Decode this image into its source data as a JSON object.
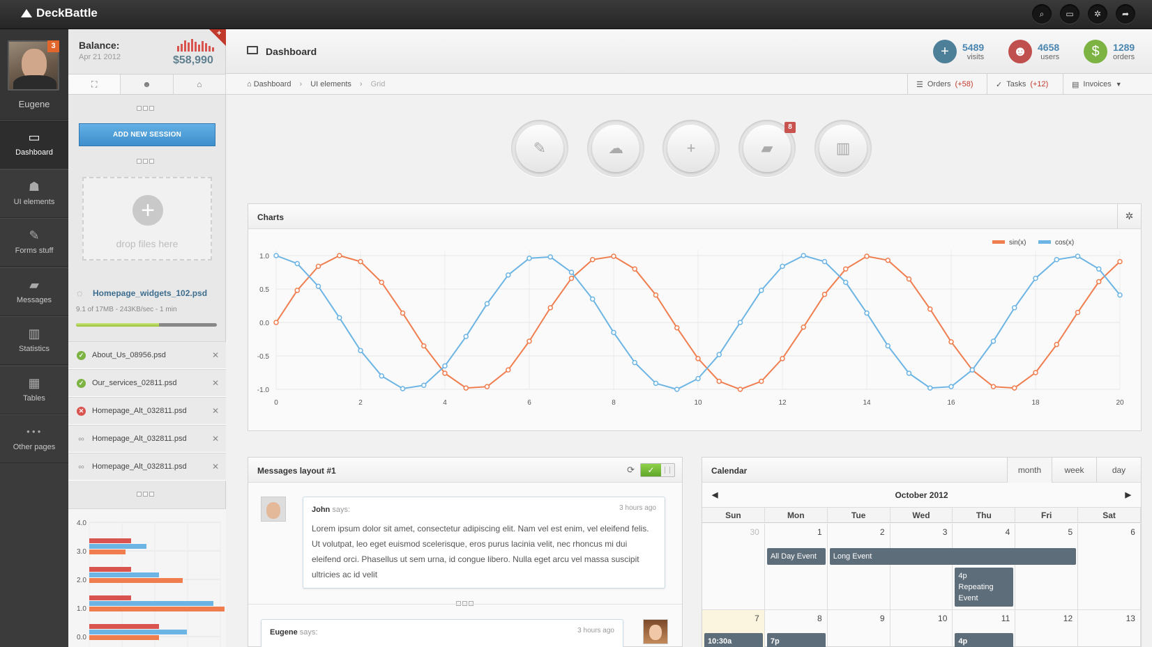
{
  "app": {
    "name": "DeckBattle"
  },
  "topbar": {
    "icons": [
      "search-icon",
      "monitor-icon",
      "gear-icon",
      "share-icon"
    ]
  },
  "user": {
    "name": "Eugene",
    "notifications": "3"
  },
  "nav": {
    "items": [
      {
        "label": "Dashboard",
        "icon": "monitor-icon",
        "glyph": "▭"
      },
      {
        "label": "UI elements",
        "icon": "users-icon",
        "glyph": "☗"
      },
      {
        "label": "Forms stuff",
        "icon": "edit-icon",
        "glyph": "✎"
      },
      {
        "label": "Messages",
        "icon": "chat-icon",
        "glyph": "▰"
      },
      {
        "label": "Statistics",
        "icon": "bar-chart-icon",
        "glyph": "▥"
      },
      {
        "label": "Tables",
        "icon": "table-icon",
        "glyph": "▦"
      },
      {
        "label": "Other pages",
        "icon": "more-icon",
        "glyph": "●●●"
      }
    ]
  },
  "balance": {
    "label": "Balance:",
    "date": "Apr 21 2012",
    "value": "$58,990",
    "ribbon": "+"
  },
  "side": {
    "add_session": "ADD NEW SESSION",
    "drop": "drop files here",
    "upload": {
      "file": "Homepage_widgets_102.psd",
      "meta": "9.1 of 17MB - 243KB/sec - 1 min",
      "progress": 0.59
    },
    "files": [
      {
        "name": "About_Us_08956.psd",
        "status": "done"
      },
      {
        "name": "Our_services_02811.psd",
        "status": "done"
      },
      {
        "name": "Homepage_Alt_032811.psd",
        "status": "error"
      },
      {
        "name": "Homepage_Alt_032811.psd",
        "status": "pending"
      },
      {
        "name": "Homepage_Alt_032811.psd",
        "status": "pending"
      }
    ],
    "mini_chart": {
      "ticks": [
        "4.0",
        "3.0",
        "2.0",
        "1.0",
        "0.0"
      ]
    }
  },
  "header": {
    "title": "Dashboard",
    "stats": [
      {
        "value": "5489",
        "label": "visits",
        "color": "#4e7f99",
        "glyph": "+"
      },
      {
        "value": "4658",
        "label": "users",
        "color": "#c0504d",
        "glyph": "☻"
      },
      {
        "value": "1289",
        "label": "orders",
        "color": "#7cb342",
        "glyph": "$"
      }
    ]
  },
  "breadcrumb": [
    "Dashboard",
    "UI elements",
    "Grid"
  ],
  "quick": {
    "orders": {
      "label": "Orders",
      "count": "(+58)"
    },
    "tasks": {
      "label": "Tasks",
      "count": "(+12)"
    },
    "invoices": {
      "label": "Invoices"
    }
  },
  "circle_buttons": [
    {
      "icon": "edit-icon",
      "glyph": "✎"
    },
    {
      "icon": "cloud-upload-icon",
      "glyph": "☁"
    },
    {
      "icon": "plus-icon",
      "glyph": "+"
    },
    {
      "icon": "chat-icon",
      "glyph": "▰"
    },
    {
      "icon": "bar-chart-icon",
      "glyph": "▥"
    }
  ],
  "circle_badge": "8",
  "charts_panel": {
    "title": "Charts"
  },
  "chart_data": {
    "type": "line",
    "title": "",
    "xlabel": "",
    "ylabel": "",
    "xlim": [
      0,
      20
    ],
    "ylim": [
      -1.0,
      1.0
    ],
    "xticks": [
      0,
      2,
      4,
      6,
      8,
      10,
      12,
      14,
      16,
      18,
      20
    ],
    "yticks": [
      "1.0",
      "0.5",
      "0.0",
      "-0.5",
      "-1.0"
    ],
    "legend_position": "top-right",
    "series": [
      {
        "name": "sin(x)",
        "color": "#f07d4e",
        "x": [
          0,
          0.5,
          1,
          1.5,
          2,
          2.5,
          3,
          3.5,
          4,
          4.5,
          5,
          5.5,
          6,
          6.5,
          7,
          7.5,
          8,
          8.5,
          9,
          9.5,
          10,
          10.5,
          11,
          11.5,
          12,
          12.5,
          13,
          13.5,
          14,
          14.5,
          15,
          15.5,
          16,
          16.5,
          17,
          17.5,
          18,
          18.5,
          19,
          19.5,
          20
        ],
        "y": [
          0,
          0.48,
          0.84,
          1.0,
          0.91,
          0.6,
          0.14,
          -0.35,
          -0.76,
          -0.98,
          -0.96,
          -0.71,
          -0.28,
          0.22,
          0.66,
          0.94,
          0.99,
          0.8,
          0.41,
          -0.08,
          -0.54,
          -0.88,
          -1.0,
          -0.88,
          -0.54,
          -0.07,
          0.42,
          0.8,
          0.99,
          0.93,
          0.65,
          0.2,
          -0.29,
          -0.71,
          -0.96,
          -0.98,
          -0.75,
          -0.33,
          0.15,
          0.61,
          0.91
        ]
      },
      {
        "name": "cos(x)",
        "color": "#6cb4e4",
        "x": [
          0,
          0.5,
          1,
          1.5,
          2,
          2.5,
          3,
          3.5,
          4,
          4.5,
          5,
          5.5,
          6,
          6.5,
          7,
          7.5,
          8,
          8.5,
          9,
          9.5,
          10,
          10.5,
          11,
          11.5,
          12,
          12.5,
          13,
          13.5,
          14,
          14.5,
          15,
          15.5,
          16,
          16.5,
          17,
          17.5,
          18,
          18.5,
          19,
          19.5,
          20
        ],
        "y": [
          1.0,
          0.88,
          0.54,
          0.07,
          -0.42,
          -0.8,
          -0.99,
          -0.94,
          -0.65,
          -0.21,
          0.28,
          0.71,
          0.96,
          0.98,
          0.75,
          0.35,
          -0.15,
          -0.6,
          -0.91,
          -1.0,
          -0.84,
          -0.48,
          0.0,
          0.48,
          0.84,
          1.0,
          0.91,
          0.6,
          0.14,
          -0.35,
          -0.76,
          -0.98,
          -0.96,
          -0.71,
          -0.28,
          0.22,
          0.66,
          0.94,
          0.99,
          0.8,
          0.41
        ]
      }
    ]
  },
  "messages": {
    "title": "Messages layout #1",
    "items": [
      {
        "author": "John",
        "says": "says:",
        "time": "3 hours ago",
        "text": "Lorem ipsum dolor sit amet, consectetur adipiscing elit. Nam vel est enim, vel eleifend felis. Ut volutpat, leo eget euismod scelerisque, eros purus lacinia velit, nec rhoncus mi dui eleifend orci. Phasellus ut sem urna, id congue libero. Nulla eget arcu vel massa suscipit ultricies ac id velit"
      },
      {
        "author": "Eugene",
        "says": "says:",
        "time": "3 hours ago",
        "text": ""
      }
    ]
  },
  "calendar": {
    "title": "Calendar",
    "views": [
      "month",
      "week",
      "day"
    ],
    "active_view": "month",
    "month": "October 2012",
    "weekdays": [
      "Sun",
      "Mon",
      "Tue",
      "Wed",
      "Thu",
      "Fri",
      "Sat"
    ],
    "week1": [
      "30",
      "1",
      "2",
      "3",
      "4",
      "5",
      "6"
    ],
    "week2": [
      "7",
      "8",
      "9",
      "10",
      "11",
      "12",
      "13"
    ],
    "events": {
      "all_day": "All Day Event",
      "long": "Long Event",
      "repeat_time": "4p",
      "repeat_name": "Repeating",
      "repeat_name2": "Event",
      "w2_sun": "10:30a",
      "w2_mon": "7p",
      "w2_thu": "4p"
    }
  }
}
